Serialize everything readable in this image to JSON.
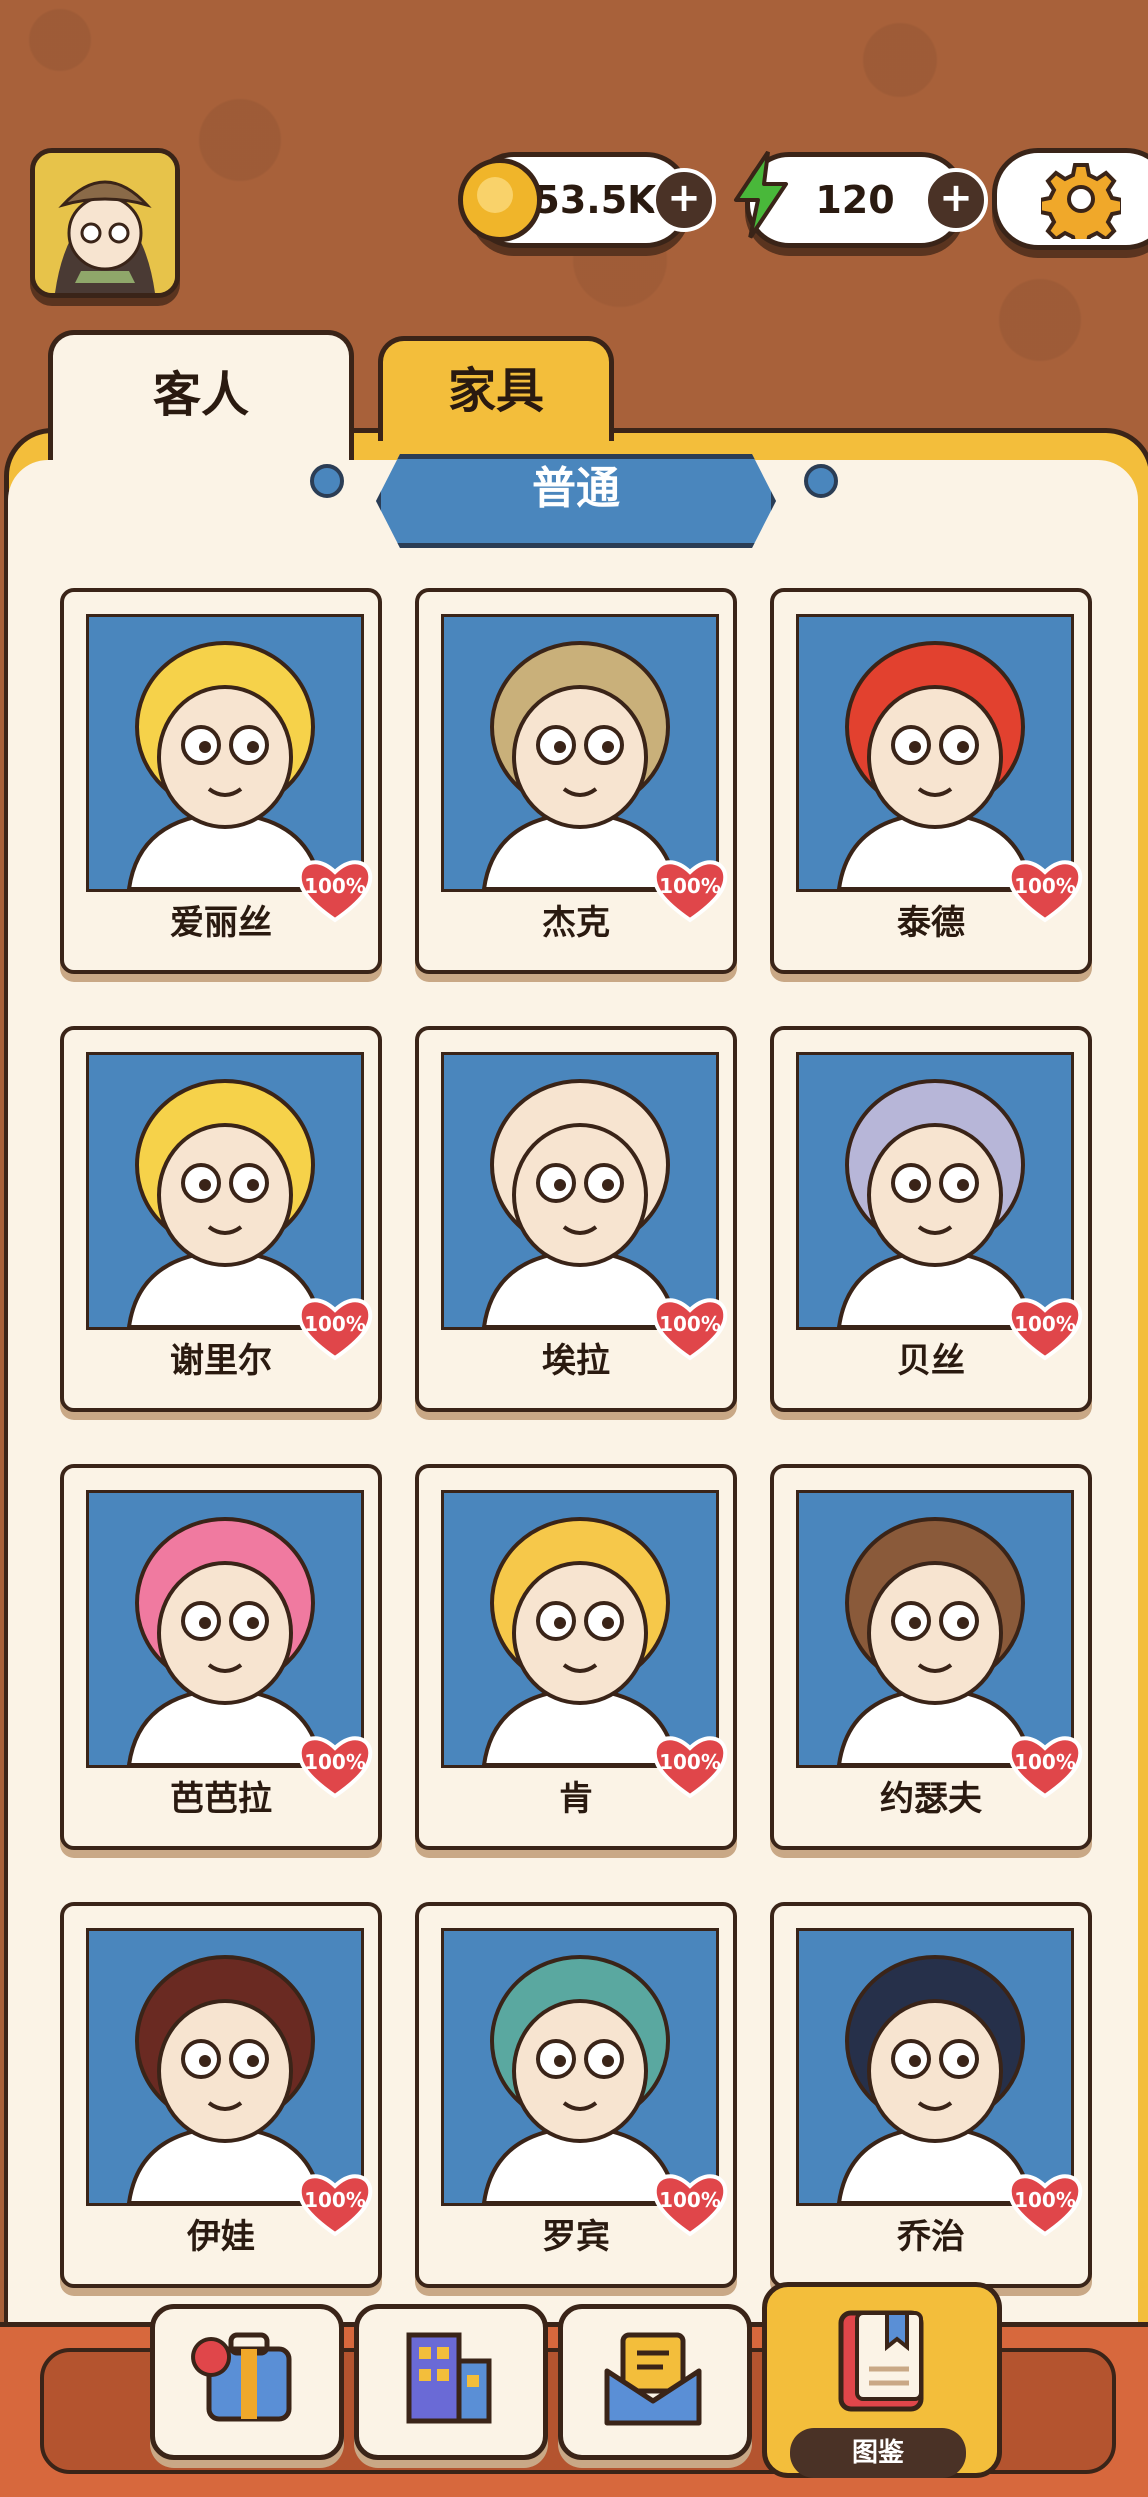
{
  "app": {
    "title": "图鉴"
  },
  "resources": {
    "coins": "53.5K",
    "energy": "120",
    "coin_icon": "coin-icon",
    "energy_icon": "lightning-icon"
  },
  "tabs": [
    {
      "label": "客人",
      "active": true
    },
    {
      "label": "家具",
      "active": false
    }
  ],
  "section": {
    "title": "普通"
  },
  "characters": [
    {
      "name": "爱丽丝",
      "affinity": "100%"
    },
    {
      "name": "杰克",
      "affinity": "100%"
    },
    {
      "name": "泰德",
      "affinity": "100%"
    },
    {
      "name": "谢里尔",
      "affinity": "100%"
    },
    {
      "name": "埃拉",
      "affinity": "100%"
    },
    {
      "name": "贝丝",
      "affinity": "100%"
    },
    {
      "name": "芭芭拉",
      "affinity": "100%"
    },
    {
      "name": "肯",
      "affinity": "100%"
    },
    {
      "name": "约瑟夫",
      "affinity": "100%"
    },
    {
      "name": "伊娃",
      "affinity": "100%"
    },
    {
      "name": "罗宾",
      "affinity": "100%"
    },
    {
      "name": "乔治",
      "affinity": "100%"
    }
  ],
  "bottom_nav": [
    {
      "icon": "suitcase-icon"
    },
    {
      "icon": "building-icon"
    },
    {
      "icon": "mail-icon"
    },
    {
      "icon": "book-icon",
      "label": "图鉴",
      "active": true
    }
  ],
  "colors": {
    "background": "#a8613a",
    "panel": "#f3be3b",
    "panel_inner": "#fbf3e6",
    "portrait_bg": "#4a86bd",
    "heart": "#e0464a",
    "nav_bar": "#d7683d"
  }
}
